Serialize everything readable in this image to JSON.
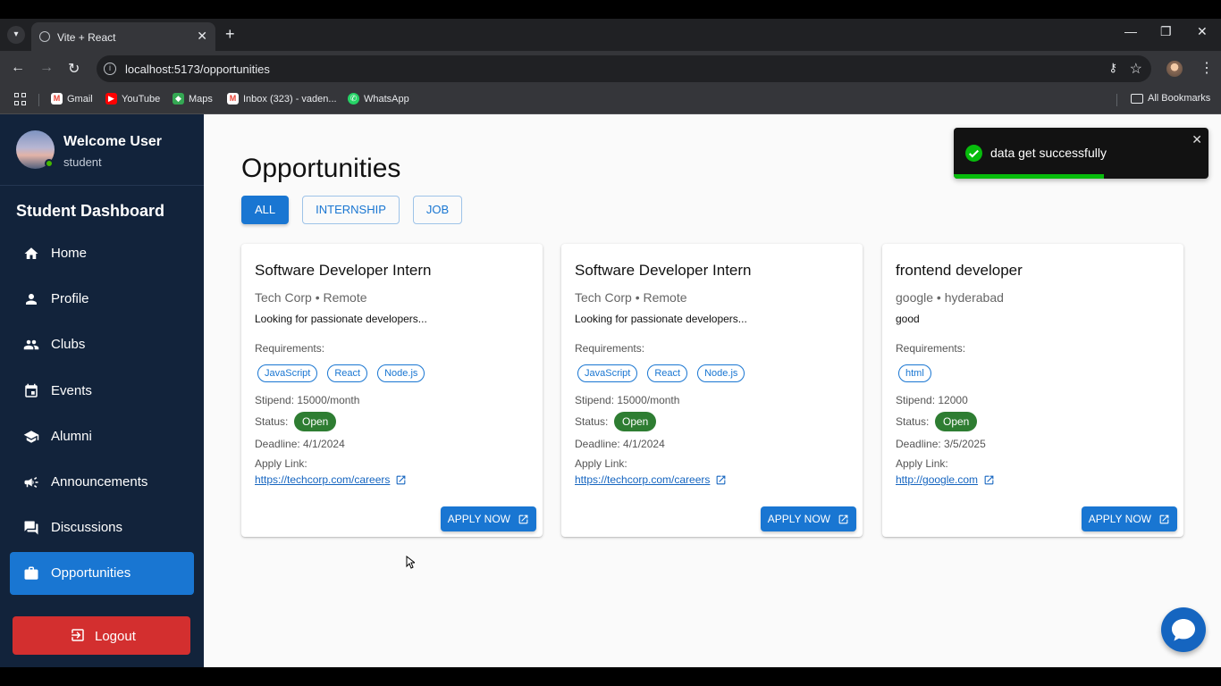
{
  "browser": {
    "tab_title": "Vite + React",
    "url": "localhost:5173/opportunities",
    "bookmarks": [
      {
        "label": "Gmail",
        "icon": "gmail-icon",
        "color": "#ea4335"
      },
      {
        "label": "YouTube",
        "icon": "youtube-icon",
        "color": "#ff0000"
      },
      {
        "label": "Maps",
        "icon": "maps-icon",
        "color": "#34a853"
      },
      {
        "label": "Inbox (323) - vaden...",
        "icon": "gmail-icon",
        "color": "#ea4335"
      },
      {
        "label": "WhatsApp",
        "icon": "whatsapp-icon",
        "color": "#25d366"
      }
    ],
    "all_bookmarks": "All Bookmarks"
  },
  "sidebar": {
    "user_name": "Welcome User",
    "user_role": "student",
    "dashboard_title": "Student Dashboard",
    "items": [
      {
        "label": "Home",
        "icon": "home-icon",
        "active": false
      },
      {
        "label": "Profile",
        "icon": "person-icon",
        "active": false
      },
      {
        "label": "Clubs",
        "icon": "group-icon",
        "active": false
      },
      {
        "label": "Events",
        "icon": "calendar-icon",
        "active": false
      },
      {
        "label": "Alumni",
        "icon": "graduation-cap-icon",
        "active": false
      },
      {
        "label": "Announcements",
        "icon": "megaphone-icon",
        "active": false
      },
      {
        "label": "Discussions",
        "icon": "forum-icon",
        "active": false
      },
      {
        "label": "Opportunities",
        "icon": "briefcase-icon",
        "active": true
      }
    ],
    "logout_label": "Logout"
  },
  "main": {
    "title": "Opportunities",
    "filters": [
      {
        "label": "ALL",
        "active": true
      },
      {
        "label": "INTERNSHIP",
        "active": false
      },
      {
        "label": "JOB",
        "active": false
      }
    ],
    "cards": [
      {
        "title": "Software Developer Intern",
        "company_location": "Tech Corp • Remote",
        "description": "Looking for passionate developers...",
        "requirements_label": "Requirements:",
        "requirements": [
          "JavaScript",
          "React",
          "Node.js"
        ],
        "stipend": "Stipend: 15000/month",
        "status_label": "Status:",
        "status": "Open",
        "deadline": "Deadline: 4/1/2024",
        "apply_link_label": "Apply Link:",
        "apply_link": "https://techcorp.com/careers",
        "apply_button": "APPLY NOW"
      },
      {
        "title": "Software Developer Intern",
        "company_location": "Tech Corp • Remote",
        "description": "Looking for passionate developers...",
        "requirements_label": "Requirements:",
        "requirements": [
          "JavaScript",
          "React",
          "Node.js"
        ],
        "stipend": "Stipend: 15000/month",
        "status_label": "Status:",
        "status": "Open",
        "deadline": "Deadline: 4/1/2024",
        "apply_link_label": "Apply Link:",
        "apply_link": "https://techcorp.com/careers",
        "apply_button": "APPLY NOW"
      },
      {
        "title": "frontend developer",
        "company_location": "google • hyderabad",
        "description": "good",
        "requirements_label": "Requirements:",
        "requirements": [
          "html"
        ],
        "stipend": "Stipend: 12000",
        "status_label": "Status:",
        "status": "Open",
        "deadline": "Deadline: 3/5/2025",
        "apply_link_label": "Apply Link:",
        "apply_link": "http://google.com",
        "apply_button": "APPLY NOW"
      }
    ]
  },
  "toast": {
    "message": "data get successfully",
    "progress": 0.59
  },
  "colors": {
    "sidebar_bg": "#12233b",
    "accent": "#1976d2",
    "logout": "#d32f2f",
    "status_open": "#2e7d32",
    "toast_success": "#07bc0c"
  }
}
